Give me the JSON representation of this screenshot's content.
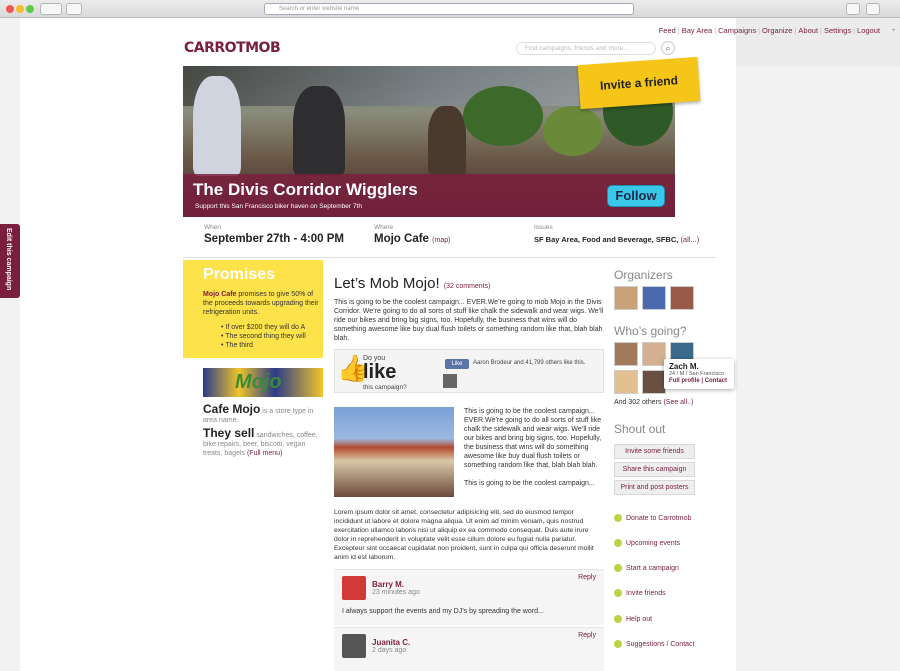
{
  "browser": {
    "url_placeholder": "Search or enter website name"
  },
  "nav": {
    "items": [
      "Feed",
      "Bay Area",
      "Campaigns",
      "Organize",
      "About",
      "Settings",
      "Logout"
    ]
  },
  "logo": {
    "text": "CARROTMOB"
  },
  "search": {
    "placeholder": "Find campaigns, friends and more..."
  },
  "hero": {
    "invite": "Invite a friend",
    "title": "The Divis Corridor Wigglers",
    "subtitle": "Support this San Francisco biker haven on September 7th",
    "follow": "Follow"
  },
  "edit_tab": "Edit this campaign",
  "info": {
    "when_label": "When",
    "when": "September 27th - 4:00 PM",
    "where_label": "Where",
    "where": "Mojo Cafe",
    "map": "(map)",
    "issues_label": "Issues",
    "issues": "SF Bay Area, Food and Beverage, SFBC,",
    "all": "(all...)"
  },
  "promises": {
    "title": "Promises",
    "cafe": "Mojo Cafe",
    "text": " promises to give 50% of the proceeds towards upgrading their refrigeration units.",
    "items": [
      "If over $200 they will do A",
      "The second thing they will",
      "The third"
    ]
  },
  "store": {
    "mojo": "Mojo",
    "name": "Cafe Mojo",
    "type": " is a store type in area name.",
    "sells": "They sell",
    "sells_text": " sandwiches, coffee, bike repairs, beer, biscotti, vegan treats, bagels ",
    "full_menu": "(Full menu)"
  },
  "main": {
    "title": "Let’s Mob Mojo!",
    "comments": "32 comments",
    "desc": "This is going to be the coolest campaign... EVER.We’re going to mob Mojo in the Divis Corridor. We’re going to do all sorts of stuff like chalk the sidewalk and wear wigs. We’ll ride our bikes and bring big signs, too. Hopefully, the business that wins will do something awesome like buy dual flush toilets or something random like that, blah blah blah.",
    "like_small": "Do you",
    "like_big": "like",
    "like_sub": "this campaign?",
    "fb_like": "Like",
    "fb_text": "Aaron Brodeur and 41,799 others like this.",
    "text2a": "This is going to be the coolest campaign... EVER.We’re going to do all sorts of stuff like chalk the sidewalk and wear wigs. We’ll ride our bikes and bring big signs, too. Hopefully, the business that wins will do something awesome like buy dual flush toilets or something random like that, blah blah blah.",
    "text2b": "This is going to be the coolest campaign...",
    "lorem": "Lorem ipsum dolor sit amet, consectetur adipisicing elit, sed do eiusmod tempor incididunt ut labore et dolore magna aliqua. Ut enim ad minim veniam, quis nostrud exercitation ullamco laboris nisi ut aliquip ex ea commodo consequat. Duis aute irure dolor in reprehenderit in voluptate velit esse cillum dolore eu fugiat nulla pariatur. Excepteur sint occaecat cupidatat non proident, sunt in culpa qui officia deserunt mollit anim id est laborum."
  },
  "comments": [
    {
      "name": "Barry M.",
      "time": "23 minutes ago",
      "reply": "Reply",
      "text": "I always support the events and my DJ’s by spreading the word..."
    },
    {
      "name": "Juanita C.",
      "time": "2 days ago",
      "reply": "Reply",
      "text": ""
    }
  ],
  "right": {
    "organizers": "Organizers",
    "whos_going": "Who’s going?",
    "zach_name": "Zach M.",
    "zach_detail": "24 / M / San Francisco",
    "zach_profile": "Full profile",
    "zach_contact": "Contact",
    "others": "And 302 others",
    "see_all": "(See all..)",
    "shout_out": "Shout out",
    "buttons": [
      "Invite some friends",
      "Share this campaign",
      "Print and post posters"
    ],
    "links": [
      "Donate to Carrotmob",
      "Upcoming events",
      "Start a campaign",
      "Invite friends",
      "Help out",
      "Suggestions / Contact"
    ]
  }
}
